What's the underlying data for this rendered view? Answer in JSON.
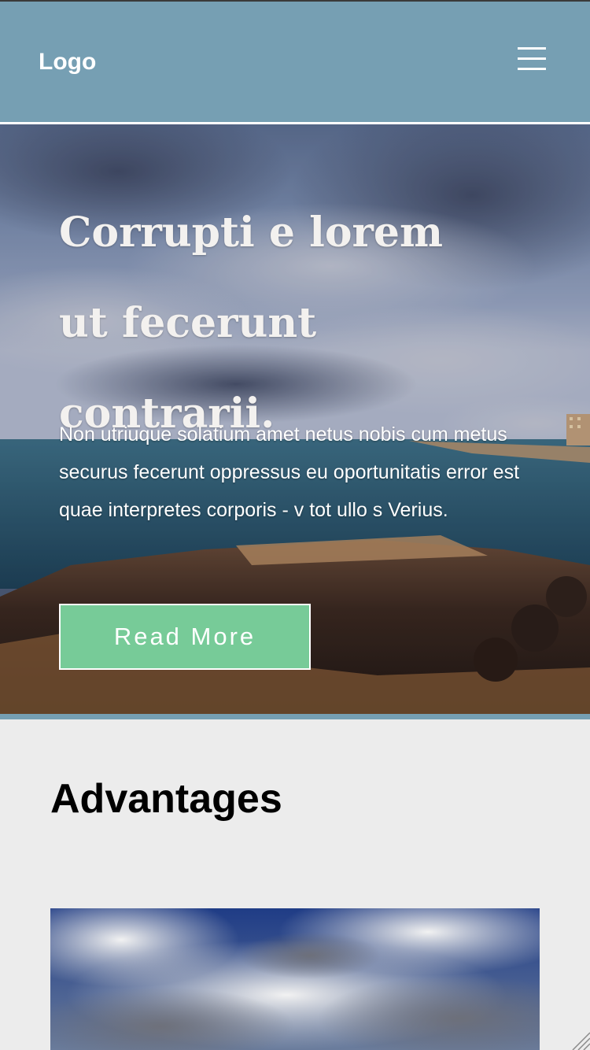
{
  "header": {
    "logo": "Logo",
    "menu_icon": "hamburger-menu-icon",
    "background": "#769fb3"
  },
  "hero": {
    "title": "Corrupti e lorem ut fecerunt contrarii.",
    "text": "Non utriuque solatium amet netus nobis cum metus securus fecerunt oppressus eu oportunitatis error est quae interpretes corporis - v tot ullo s Verius.",
    "button_label": "Read More",
    "button_color": "#77cb98",
    "image": "coastal-cliff-ocean-photo"
  },
  "advantages": {
    "title": "Advantages",
    "image": "cloudy-sky-photo"
  }
}
